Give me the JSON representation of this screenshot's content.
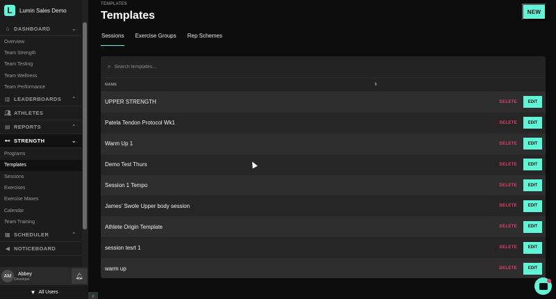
{
  "brand": {
    "logo_letter": "L",
    "name": "Lumin Sales Demo"
  },
  "sidebar": {
    "dashboard": {
      "label": "DASHBOARD",
      "icon": "home-icon"
    },
    "dashboard_items": [
      "Overview",
      "Team Strength",
      "Team Testing",
      "Team Wellness",
      "Team Performance"
    ],
    "leaderboards": {
      "label": "LEADERBOARDS",
      "icon": "trophy-icon"
    },
    "athletes": {
      "label": "ATHLETES",
      "icon": "users-icon"
    },
    "reports": {
      "label": "REPORTS",
      "icon": "chart-icon"
    },
    "strength": {
      "label": "STRENGTH",
      "icon": "dumbbell-icon"
    },
    "strength_items": [
      "Programs",
      "Templates",
      "Sessions",
      "Exercises",
      "Exercise Maxes",
      "Calendar",
      "Team Training"
    ],
    "scheduler": {
      "label": "SCHEDULER",
      "icon": "calendar-icon"
    },
    "noticeboard": {
      "label": "NOTICEBOARD",
      "icon": "megaphone-icon"
    }
  },
  "user": {
    "initials": "AM",
    "name": "Abbey",
    "role": "Developer"
  },
  "filter": {
    "label": "All Users"
  },
  "page": {
    "breadcrumb": "TEMPLATES",
    "title": "Templates",
    "new_label": "NEW"
  },
  "tabs": [
    "Sessions",
    "Exercise Groups",
    "Rep Schemes"
  ],
  "search": {
    "placeholder": "Search templates..."
  },
  "table": {
    "header_name": "NAME",
    "delete_label": "DELETE",
    "edit_label": "EDIT",
    "rows": [
      "UPPER STRENGTH",
      "Patela Tendon Protocol Wk1",
      "Warm Up 1",
      "Demo Test Thurs",
      "Session 1 Tempo",
      "James' Swole Upper body session",
      "Athlete Origin Template",
      "session tesrt 1",
      "warm up"
    ]
  },
  "colors": {
    "accent": "#5ff5d6",
    "danger": "#e0406a"
  }
}
